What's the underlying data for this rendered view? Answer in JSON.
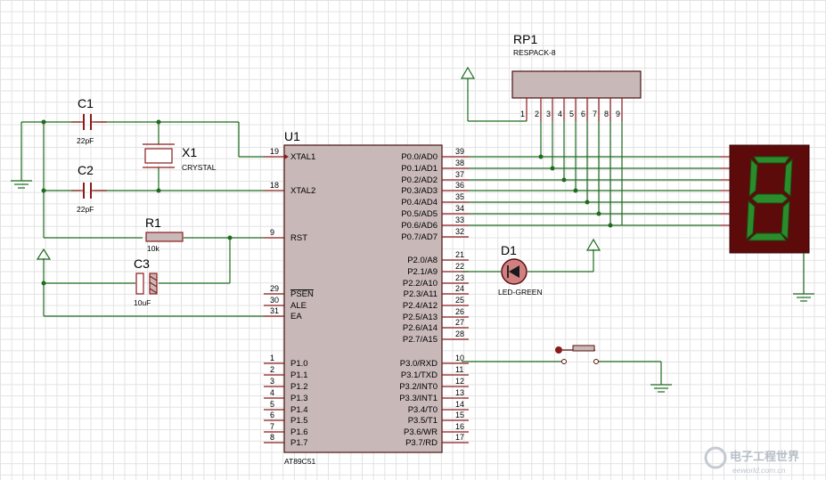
{
  "components": {
    "c1": {
      "ref": "C1",
      "value": "22pF"
    },
    "c2": {
      "ref": "C2",
      "value": "22pF"
    },
    "x1": {
      "ref": "X1",
      "value": "CRYSTAL"
    },
    "r1": {
      "ref": "R1",
      "value": "10k"
    },
    "c3": {
      "ref": "C3",
      "value": "10uF"
    },
    "rp1": {
      "ref": "RP1",
      "value": "RESPACK-8",
      "pins": [
        "1",
        "2",
        "3",
        "4",
        "5",
        "6",
        "7",
        "8",
        "9"
      ]
    },
    "d1": {
      "ref": "D1",
      "value": "LED-GREEN"
    },
    "display": {
      "digit": "8"
    },
    "u1": {
      "ref": "U1",
      "value": "AT89C51",
      "left_pins": [
        {
          "num": "19",
          "name": "XTAL1"
        },
        {
          "num": "18",
          "name": "XTAL2"
        },
        {
          "num": "9",
          "name": "RST"
        },
        {
          "num": "29",
          "name": "PSEN"
        },
        {
          "num": "30",
          "name": "ALE"
        },
        {
          "num": "31",
          "name": "EA"
        },
        {
          "num": "1",
          "name": "P1.0"
        },
        {
          "num": "2",
          "name": "P1.1"
        },
        {
          "num": "3",
          "name": "P1.2"
        },
        {
          "num": "4",
          "name": "P1.3"
        },
        {
          "num": "5",
          "name": "P1.4"
        },
        {
          "num": "6",
          "name": "P1.5"
        },
        {
          "num": "7",
          "name": "P1.6"
        },
        {
          "num": "8",
          "name": "P1.7"
        }
      ],
      "right_pins": [
        {
          "num": "39",
          "name": "P0.0/AD0"
        },
        {
          "num": "38",
          "name": "P0.1/AD1"
        },
        {
          "num": "37",
          "name": "P0.2/AD2"
        },
        {
          "num": "36",
          "name": "P0.3/AD3"
        },
        {
          "num": "35",
          "name": "P0.4/AD4"
        },
        {
          "num": "34",
          "name": "P0.5/AD5"
        },
        {
          "num": "33",
          "name": "P0.6/AD6"
        },
        {
          "num": "32",
          "name": "P0.7/AD7"
        },
        {
          "num": "21",
          "name": "P2.0/A8"
        },
        {
          "num": "22",
          "name": "P2.1/A9"
        },
        {
          "num": "23",
          "name": "P2.2/A10"
        },
        {
          "num": "24",
          "name": "P2.3/A11"
        },
        {
          "num": "25",
          "name": "P2.4/A12"
        },
        {
          "num": "26",
          "name": "P2.5/A13"
        },
        {
          "num": "27",
          "name": "P2.6/A14"
        },
        {
          "num": "28",
          "name": "P2.7/A15"
        },
        {
          "num": "10",
          "name": "P3.0/RXD"
        },
        {
          "num": "11",
          "name": "P3.1/TXD"
        },
        {
          "num": "12",
          "name": "P3.2/INT0"
        },
        {
          "num": "13",
          "name": "P3.3/INT1"
        },
        {
          "num": "14",
          "name": "P3.4/T0"
        },
        {
          "num": "15",
          "name": "P3.5/T1"
        },
        {
          "num": "16",
          "name": "P3.6/WR"
        },
        {
          "num": "17",
          "name": "P3.7/RD"
        }
      ]
    }
  },
  "watermark": {
    "text": "电子工程世界",
    "sub": "eeworld.com.cn"
  },
  "colors": {
    "wire": "#1f6b1f",
    "pin": "#8b1a1a",
    "chip_fill": "#c8b8b8",
    "display_bg": "#5c0a0a",
    "segment": "#2c8c2c"
  }
}
